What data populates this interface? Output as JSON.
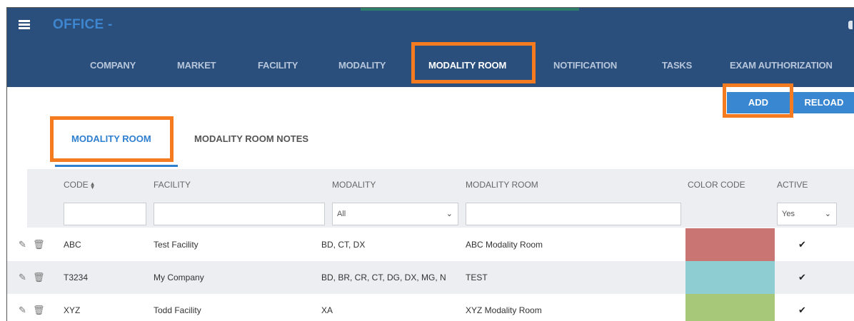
{
  "app": {
    "title": "OFFICE -"
  },
  "nav": {
    "items": [
      {
        "label": "COMPANY"
      },
      {
        "label": "MARKET"
      },
      {
        "label": "FACILITY"
      },
      {
        "label": "MODALITY"
      },
      {
        "label": "MODALITY ROOM",
        "active": true
      },
      {
        "label": "NOTIFICATION"
      },
      {
        "label": "TASKS"
      },
      {
        "label": "EXAM AUTHORIZATION"
      }
    ]
  },
  "toolbar": {
    "add_label": "ADD",
    "reload_label": "RELOAD"
  },
  "subtabs": [
    {
      "label": "MODALITY ROOM",
      "active": true
    },
    {
      "label": "MODALITY ROOM NOTES",
      "active": false
    }
  ],
  "table": {
    "columns": [
      "CODE",
      "FACILITY",
      "MODALITY",
      "MODALITY ROOM",
      "COLOR CODE",
      "ACTIVE"
    ],
    "sort_icon": "sort-icon",
    "filters": {
      "code": "",
      "facility": "",
      "modality": "All",
      "modality_room": "",
      "active": "Yes"
    },
    "rows": [
      {
        "code": "ABC",
        "facility": "Test Facility",
        "modality": "BD, CT, DX",
        "room": "ABC Modality Room",
        "color": "#c87573",
        "active": true
      },
      {
        "code": "T3234",
        "facility": "My Company",
        "modality": "BD, BR, CR, CT, DG, DX, MG, N",
        "room": "TEST",
        "color": "#8ecdd2",
        "active": true
      },
      {
        "code": "XYZ",
        "facility": "Todd Facility",
        "modality": "XA",
        "room": "XYZ Modality Room",
        "color": "#a8c879",
        "active": true
      }
    ]
  },
  "icons": {
    "edit": "pencil-icon",
    "delete": "trash-icon",
    "check": "checkmark-icon",
    "menu": "hamburger-icon"
  },
  "colors": {
    "header_bg": "#2b4f7c",
    "accent": "#3a87d1",
    "highlight": "#f47b20"
  }
}
